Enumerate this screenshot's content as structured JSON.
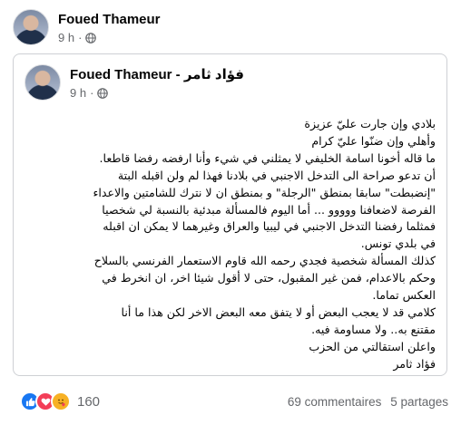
{
  "post": {
    "author": "Foued Thameur",
    "time": "9 h",
    "separator": "·"
  },
  "shared": {
    "author": "Foued Thameur - فؤاد ثامر",
    "time": "9 h",
    "separator": "·",
    "lines": [
      "بلادي وإن جارت عليّ عزيزة",
      "وأهلي وإن ضنّوا عليّ كرام",
      "ما قاله أخونا اسامة الخليفي لا يمثلني في شيء وأنا ارفضه رفضا قاطعا.",
      "أن تدعو صراحة الى التدخل الاجنبي في بلادنا فهذا لم ولن اقبله البتة",
      "\"إنضبطت\" سابقا بمنطق \"الرجلة\" و بمنطق ان لا نترك للشامتين والاعداء",
      "الفرصة لاضعافنا ووووو ... أما اليوم فالمسألة مبدئية بالنسبة لي شخصيا",
      "فمثلما رفضنا التدخل الاجنبي في ليبيا والعراق وغيرهما لا يمكن ان اقبله",
      "في بلدي تونس.",
      "كذلك المسألة شخصية فجدي رحمه الله قاوم الاستعمار الفرنسي بالسلاح",
      "وحكم بالاعدام، فمن غير المقبول، حتى لا أقول شيئا اخر، ان انخرط في",
      "العكس تماما.",
      "كلامي قد لا يعجب البعض أو لا يتفق معه البعض الاخر لكن هذا ما أنا",
      "مقتنع به.. ولا مساومة فيه.",
      "واعلن استقالتي من الحزب",
      "فؤاد ثامر"
    ]
  },
  "footer": {
    "reaction_count": "160",
    "comments": "69 commentaires",
    "shares": "5 partages"
  },
  "icons": {
    "globe": "globe-icon",
    "like": "like-icon",
    "love": "love-icon",
    "care": "care-icon"
  },
  "colors": {
    "secondary_text": "#65676b",
    "like": "#1877f2",
    "love": "#f33e58",
    "care": "#f7b125",
    "card_border": "#ced0d4"
  }
}
